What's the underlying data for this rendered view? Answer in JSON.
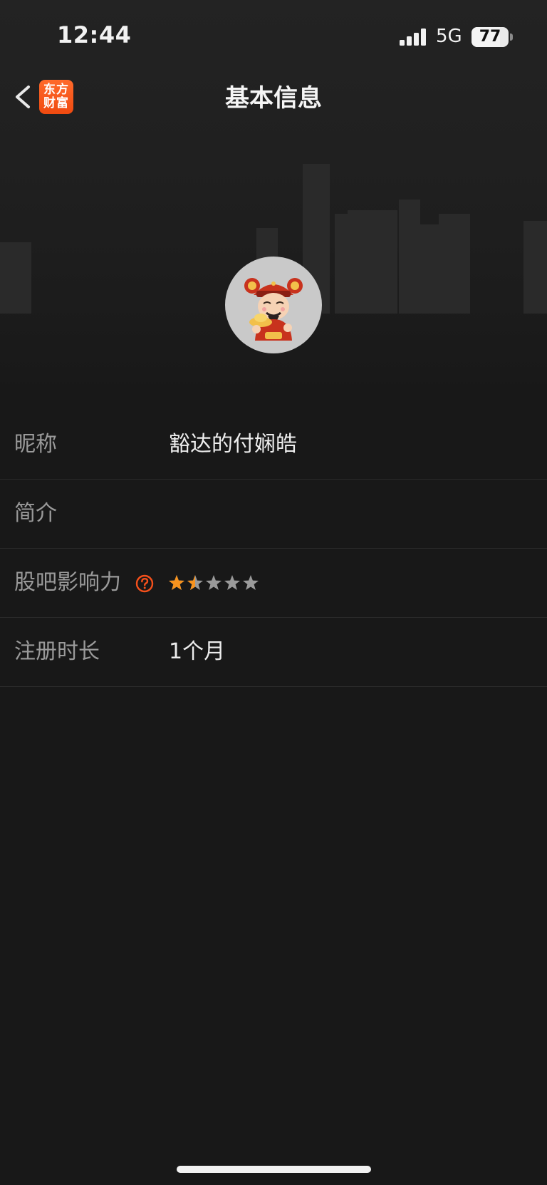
{
  "status_bar": {
    "time": "12:44",
    "network": "5G",
    "battery_level": "77",
    "battery_fraction": 0.77
  },
  "nav": {
    "title": "基本信息",
    "logo_text": "东方财富",
    "back_icon": "chevron-left-icon"
  },
  "profile": {
    "avatar_icon": "caishen-avatar-icon",
    "rows": [
      {
        "label": "昵称",
        "value": "豁达的付娴皓"
      },
      {
        "label": "简介",
        "value": ""
      },
      {
        "label": "股吧影响力",
        "value": "",
        "rating": 1.5,
        "rating_max": 5
      },
      {
        "label": "注册时长",
        "value": "1个月"
      }
    ]
  },
  "colors": {
    "background": "#181818",
    "accent": "#f5501b",
    "star_filled": "#f7931e",
    "star_empty": "#9a9a9a"
  }
}
